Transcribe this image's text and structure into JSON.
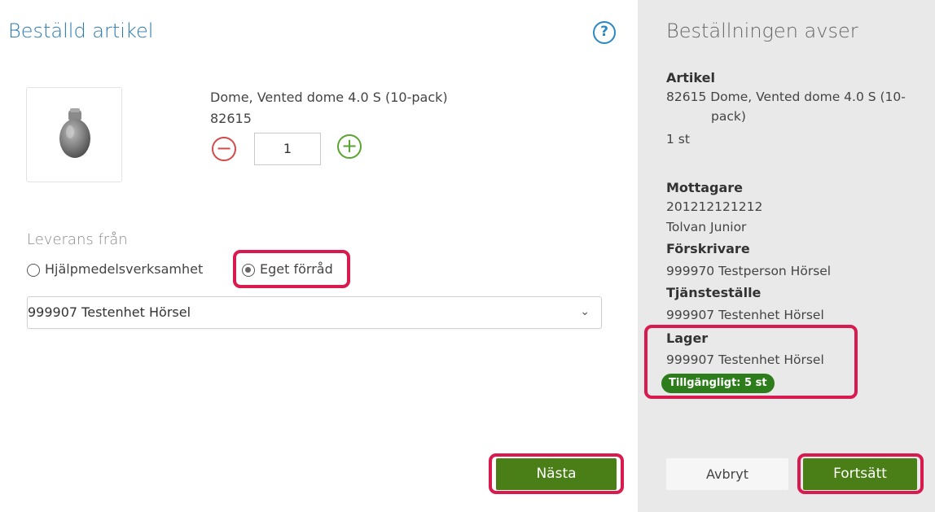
{
  "left": {
    "title": "Beställd artikel",
    "help_icon": "question-circle-icon",
    "product": {
      "name": "Dome, Vented dome 4.0 S (10-pack)",
      "sku": "82615",
      "image_icon": "hearing-aid-dome-icon",
      "quantity": "1",
      "minus_icon": "minus-circle-icon",
      "plus_icon": "plus-circle-icon"
    },
    "delivery": {
      "label": "Leverans från",
      "options": [
        "Hjälpmedelsverksamhet",
        "Eget förråd"
      ],
      "selected": "Eget förråd"
    },
    "unit_select": {
      "value": "999907 Testenhet Hörsel",
      "chevron_icon": "chevron-down-icon"
    },
    "next_button": "Nästa"
  },
  "right": {
    "title": "Beställningen avser",
    "article": {
      "heading": "Artikel",
      "line1": "82615 Dome, Vented dome 4.0 S (10-",
      "line2": "pack)",
      "quantity": "1 st"
    },
    "recipient": {
      "heading": "Mottagare",
      "id": "201212121212",
      "name": "Tolvan Junior"
    },
    "prescriber": {
      "heading": "Förskrivare",
      "value": "999970 Testperson Hörsel"
    },
    "service_location": {
      "heading": "Tjänsteställe",
      "value": "999907 Testenhet Hörsel"
    },
    "stock": {
      "heading": "Lager",
      "value": "999907 Testenhet Hörsel",
      "availability": "Tillgängligt: 5 st"
    },
    "cancel_button": "Avbryt",
    "continue_button": "Fortsätt"
  },
  "colors": {
    "accent_blue": "#2a7ab0",
    "button_green": "#4a7f17",
    "badge_green": "#2d7d1c",
    "highlight_red": "#d91a4e",
    "minus_red": "#d24a4a",
    "plus_green": "#58a52d"
  }
}
